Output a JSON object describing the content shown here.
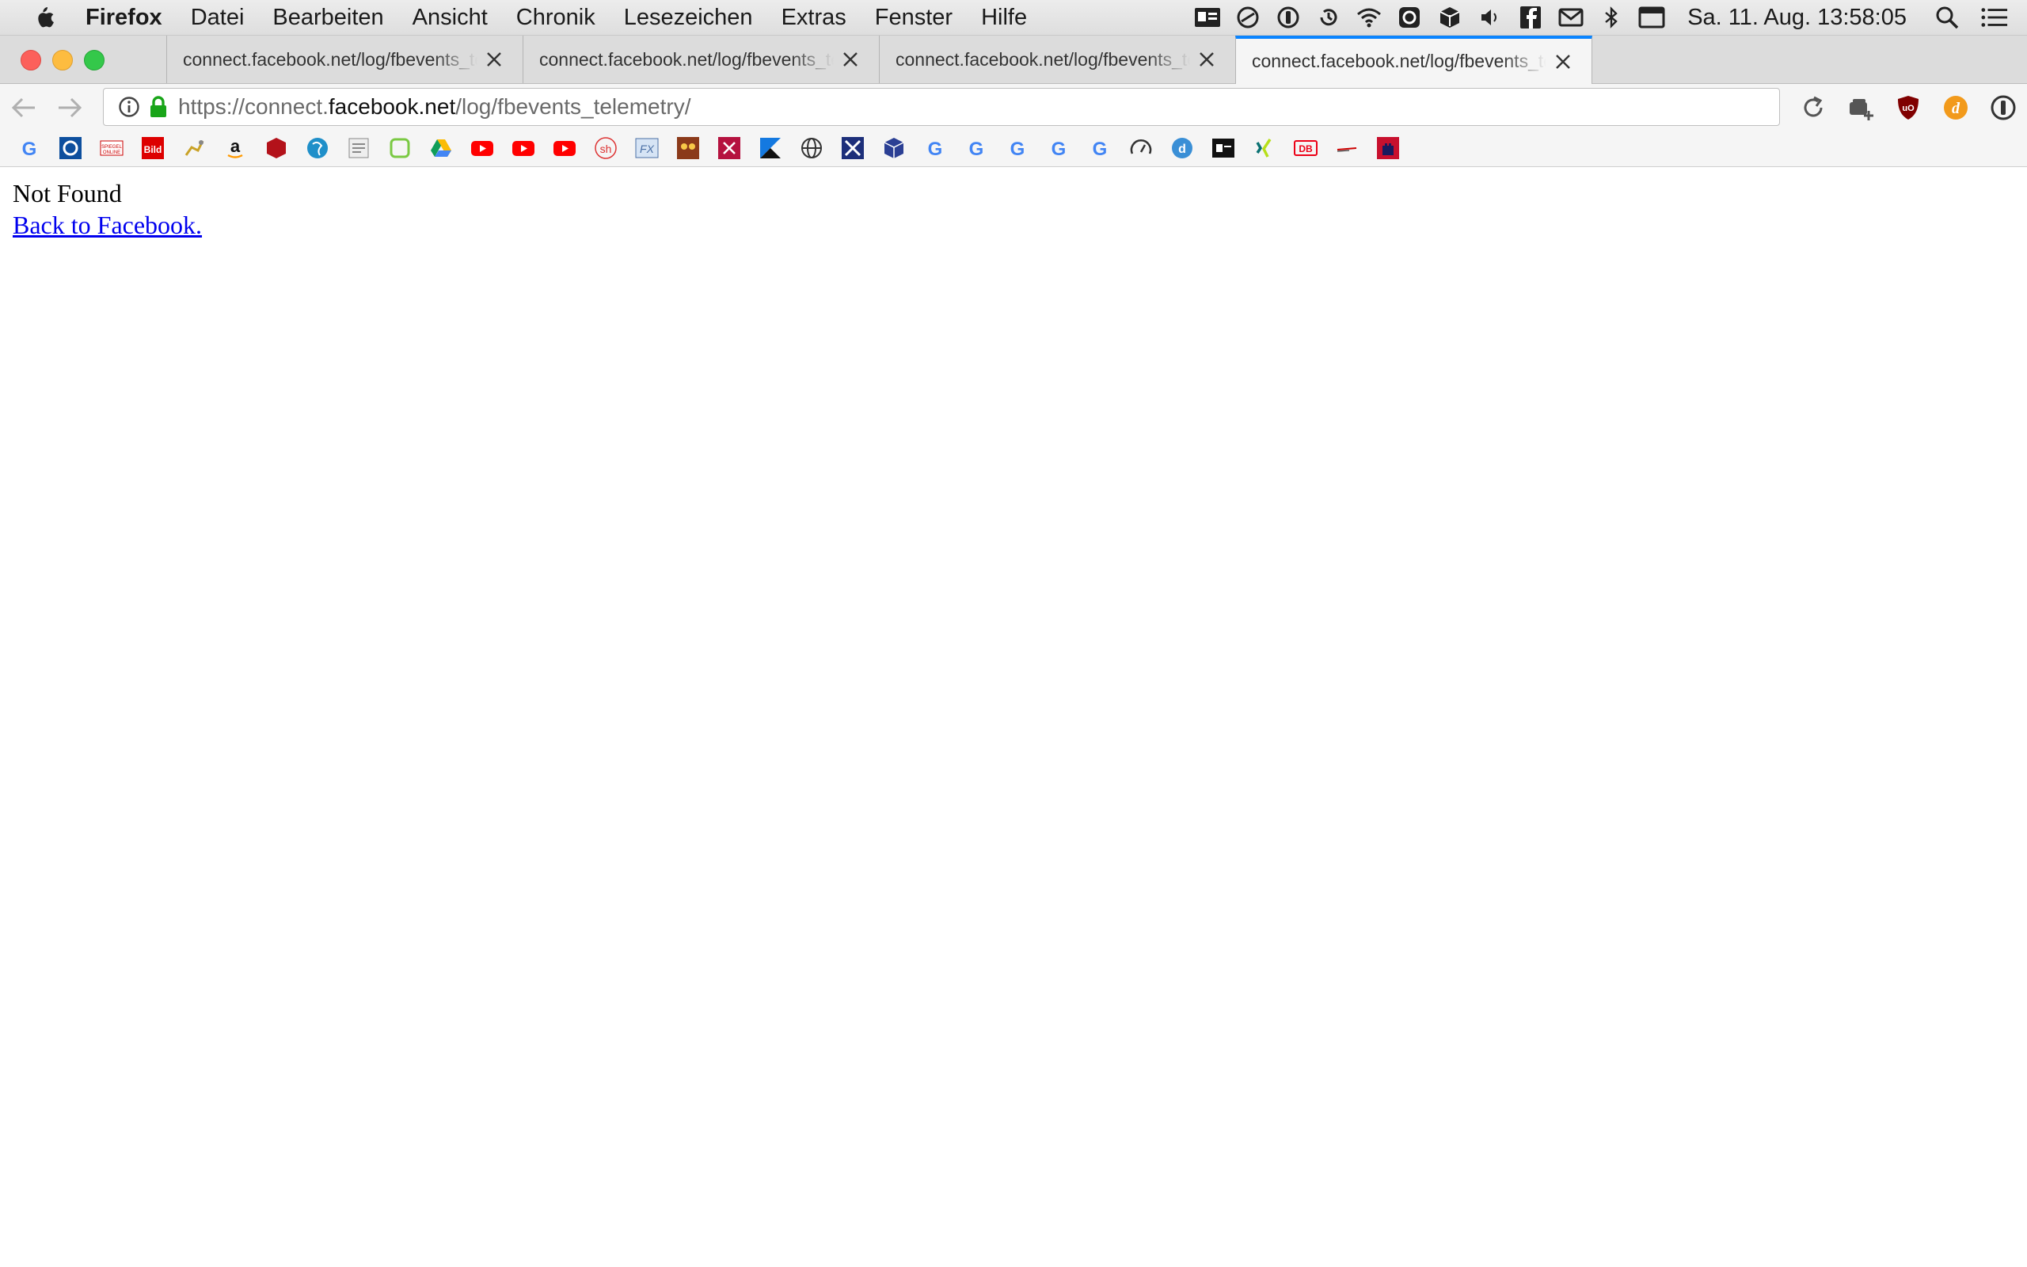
{
  "menubar": {
    "app_name": "Firefox",
    "items": [
      "Datei",
      "Bearbeiten",
      "Ansicht",
      "Chronik",
      "Lesezeichen",
      "Extras",
      "Fenster",
      "Hilfe"
    ],
    "tray_icons": [
      "contacts-icon",
      "blocked-circle-icon",
      "1password-icon",
      "timemachine-icon",
      "wifi-icon",
      "camera-icon",
      "box-icon",
      "volume-icon",
      "facebook-icon",
      "mail-icon",
      "bluetooth-icon",
      "window-icon"
    ],
    "clock": "Sa. 11. Aug.  13:58:05",
    "search_icon": "spotlight-search-icon",
    "list_icon": "notification-list-icon"
  },
  "tabs": [
    {
      "title": "connect.facebook.net/log/fbevents_telemetry/",
      "active": false
    },
    {
      "title": "connect.facebook.net/log/fbevents_telemetry/",
      "active": false
    },
    {
      "title": "connect.facebook.net/log/fbevents_telemetry/",
      "active": false
    },
    {
      "title": "connect.facebook.net/log/fbevents_telemetry/",
      "active": true
    }
  ],
  "urlbar": {
    "prefix": "https://connect.",
    "host": "facebook.net",
    "path": "/log/fbevents_telemetry/"
  },
  "toolbar_icons": [
    "reload-icon",
    "container-tab-icon",
    "ublock-icon",
    "disconnect-icon",
    "info-extension-icon"
  ],
  "bookmarks": [
    "google-icon",
    "chip-icon",
    "spiegel-online-icon",
    "bild-icon",
    "deer-icon",
    "amazon-icon",
    "red-cube-icon",
    "globe-bird-icon",
    "notepad-icon",
    "green-square-icon",
    "google-drive-icon",
    "youtube-icon",
    "youtube-icon",
    "youtube-icon",
    "sh-icon",
    "fx-icon",
    "owl-icon",
    "pink-x-icon",
    "blue-k-icon",
    "web-globe-icon",
    "blue-x-icon",
    "blue-cube-icon",
    "google-icon",
    "google-icon",
    "google-icon",
    "google-icon",
    "google-icon",
    "speedometer-icon",
    "d-icon",
    "dark-logo-icon",
    "xing-icon",
    "db-icon",
    "red-line-icon",
    "red-castle-icon"
  ],
  "content": {
    "heading": "Not Found",
    "link": "Back to Facebook."
  },
  "colors": {
    "accent": "#0a84ff",
    "lock": "#19a519",
    "link": "#0000ee"
  }
}
